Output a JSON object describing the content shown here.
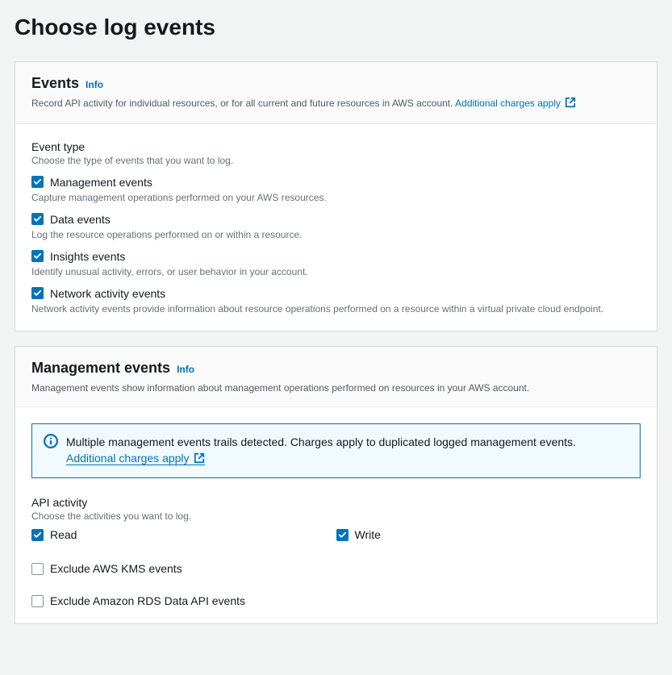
{
  "page": {
    "title": "Choose log events"
  },
  "events_panel": {
    "title": "Events",
    "info": "Info",
    "desc": "Record API activity for individual resources, or for all current and future resources in AWS account. ",
    "charges_link": "Additional charges apply",
    "event_type_label": "Event type",
    "event_type_hint": "Choose the type of events that you want to log.",
    "items": [
      {
        "label": "Management events",
        "desc": "Capture management operations performed on your AWS resources.",
        "checked": true
      },
      {
        "label": "Data events",
        "desc": "Log the resource operations performed on or within a resource.",
        "checked": true
      },
      {
        "label": "Insights events",
        "desc": "Identify unusual activity, errors, or user behavior in your account.",
        "checked": true
      },
      {
        "label": "Network activity events",
        "desc": "Network activity events provide information about resource operations performed on a resource within a virtual private cloud endpoint.",
        "checked": true
      }
    ]
  },
  "management_panel": {
    "title": "Management events",
    "info": "Info",
    "desc": "Management events show information about management operations performed on resources in your AWS account.",
    "alert_text": "Multiple management events trails detected. Charges apply to duplicated logged management events.",
    "alert_link": "Additional charges apply",
    "api_activity_label": "API activity",
    "api_activity_hint": "Choose the activities you want to log.",
    "read_label": "Read",
    "write_label": "Write",
    "exclude_kms_label": "Exclude AWS KMS events",
    "exclude_rds_label": "Exclude Amazon RDS Data API events"
  }
}
